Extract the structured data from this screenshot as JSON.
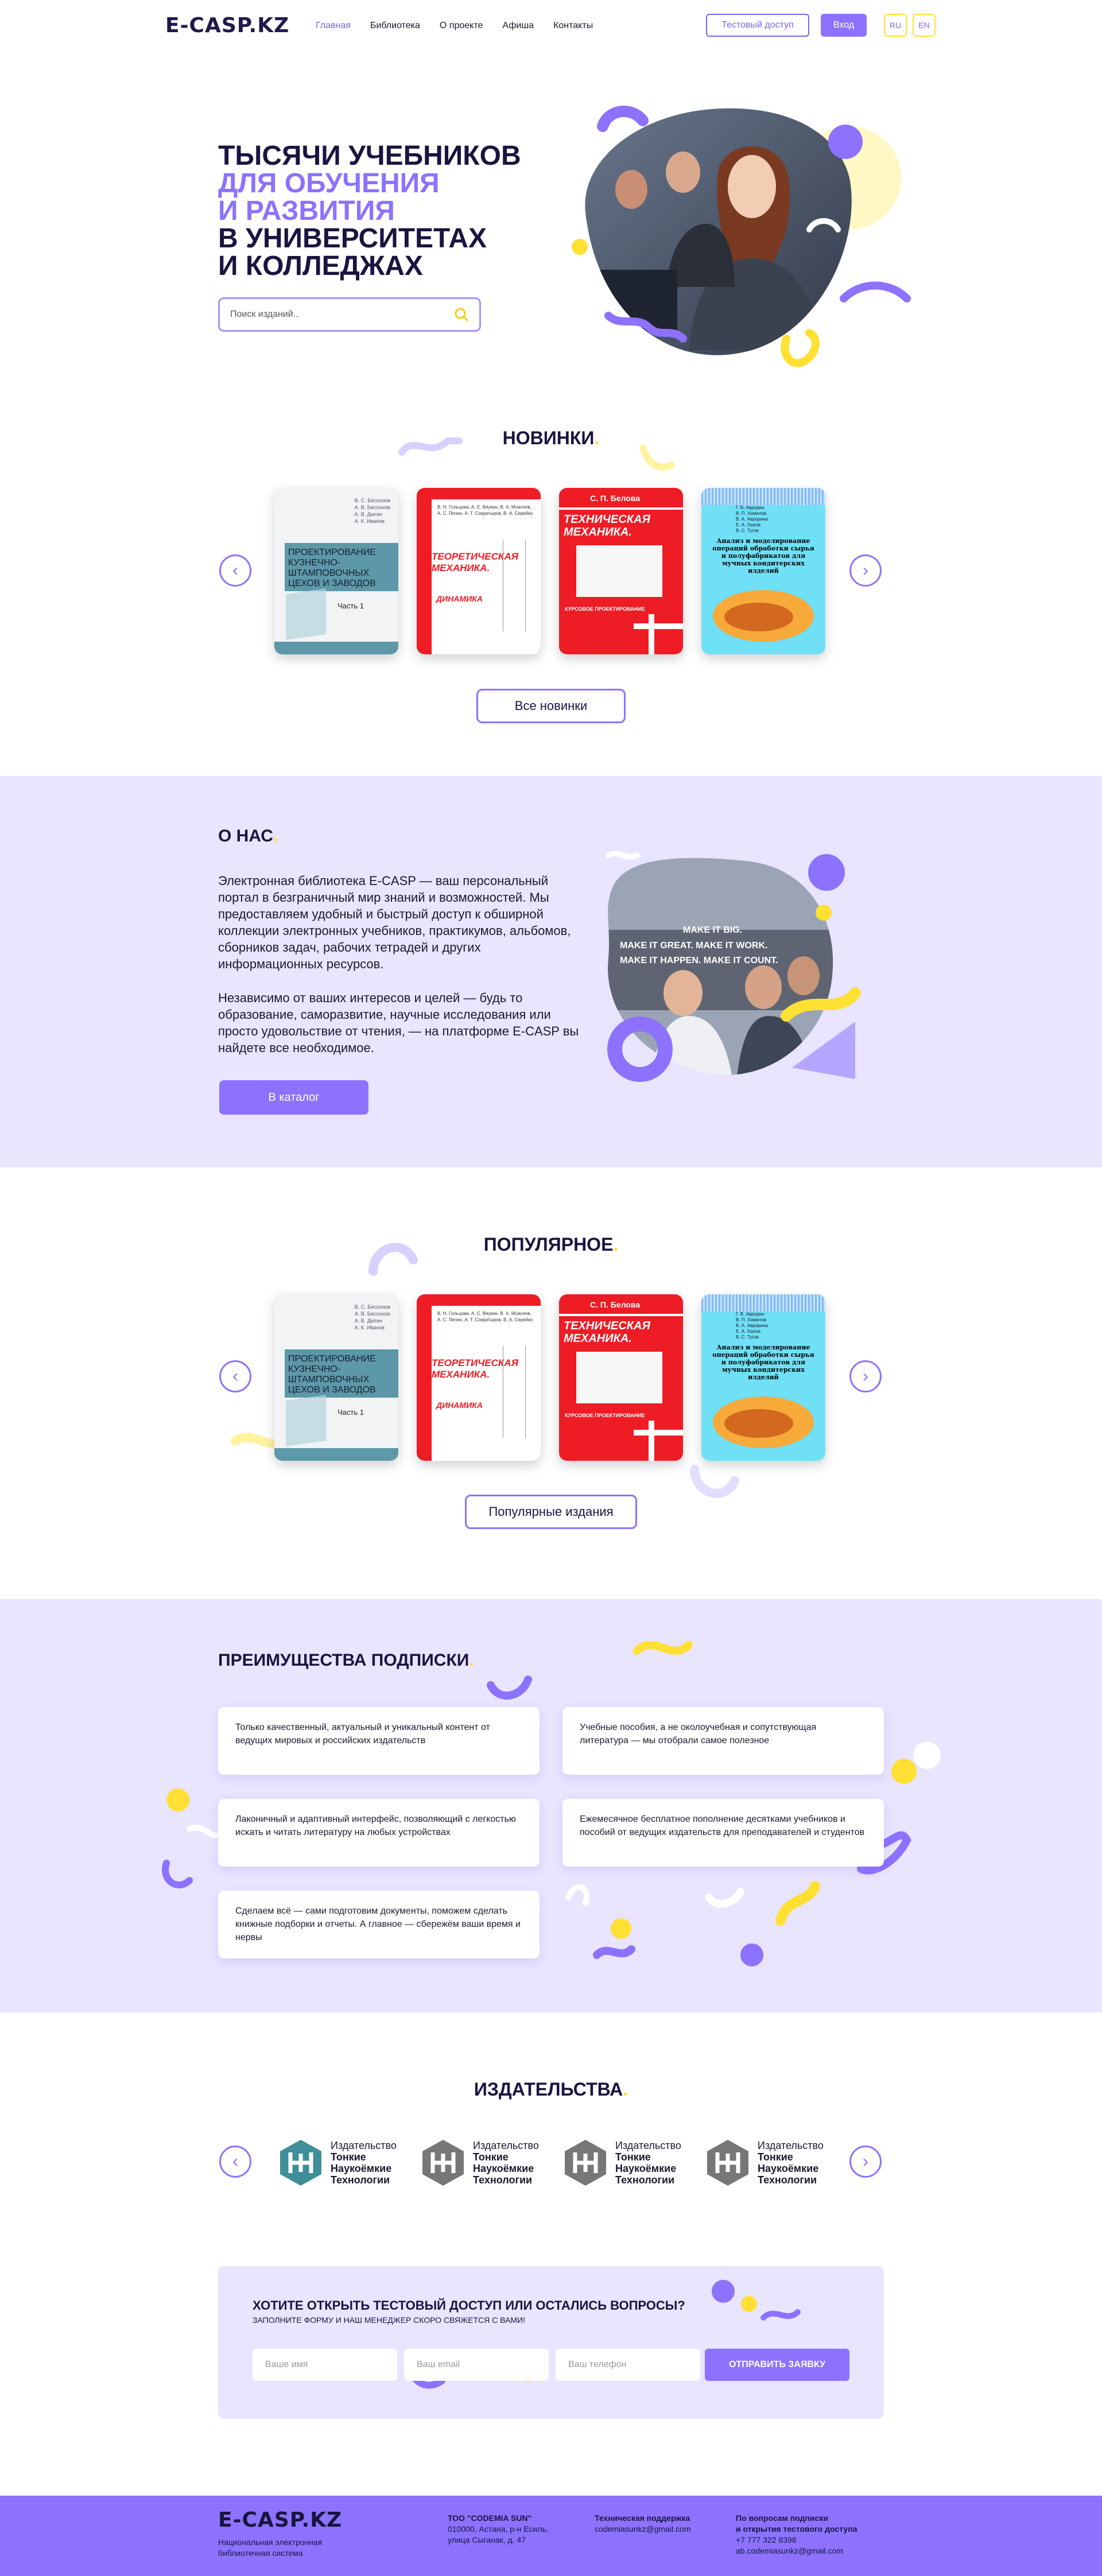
{
  "header": {
    "logo": "E-CASP.KZ",
    "nav": [
      "Главная",
      "Библиотека",
      "О проекте",
      "Афиша",
      "Контакты"
    ],
    "test_access": "Тестовый доступ",
    "login": "Вход",
    "lang_ru": "RU",
    "lang_en": "EN"
  },
  "hero": {
    "line1": "ТЫСЯЧИ УЧЕБНИКОВ",
    "line2": "ДЛЯ ОБУЧЕНИЯ",
    "line3": "И РАЗВИТИЯ",
    "line4": "В УНИВЕРСИТЕТАХ",
    "line5": "И КОЛЛЕДЖАХ",
    "search_placeholder": "Поиск изданий.."
  },
  "new": {
    "title": "НОВИНКИ",
    "button": "Все новинки"
  },
  "books": [
    {
      "authors": "В. С. Бессонов\nА. В. Бессонов\nА. В. Дюгин\nА. К. Иванов",
      "title": "ПРОЕКТИРОВАНИЕ КУЗНЕЧНО-ШТАМПОВОЧНЫХ ЦЕХОВ И ЗАВОДОВ",
      "part": "Часть 1"
    },
    {
      "authors": "В. Н. Гольцова, А. С. Вяукин, В. А. Моисеев, А. С. Лепин, А. Т. Сократыров, В. А. Серейко",
      "title": "ТЕОРЕТИЧЕСКАЯ МЕХАНИКА.",
      "sub": "ДИНАМИКА"
    },
    {
      "authors": "С. П. Белова",
      "title": "ТЕХНИЧЕСКАЯ МЕХАНИКА.",
      "sub": "КУРСОВОЕ ПРОЕКТИРОВАНИЕ"
    },
    {
      "authors": "Г. В. Аврорин\nВ. П. Хомилов\nВ. А. Аврорина\nЕ. А. Ушков\nВ. С. Тугов",
      "title": "Анализ и моделирование операций обработки сырья и полуфабрикатов для мучных кондитерских изделий"
    }
  ],
  "about": {
    "title": "О НАС",
    "p1": "Электронная библиотека E-CASP — ваш персональный портал в безграничный мир знаний и возможностей. Мы предоставляем удобный и быстрый доступ к обширной коллекции электронных учебников, практикумов, альбомов, сборников задач, рабочих тетрадей и других информационных ресурсов.",
    "p2": "Независимо от ваших интересов и целей — будь то образование, саморазвитие, научные исследования или просто удовольствие от чтения, — на платформе E-CASP вы найдете все необходимое.",
    "button": "В каталог",
    "img_text1": "MAKE IT BIG.",
    "img_text2": "MAKE IT GREAT. MAKE IT WORK.",
    "img_text3": "MAKE IT HAPPEN. MAKE IT COUNT."
  },
  "popular": {
    "title": "ПОПУЛЯРНОЕ",
    "button": "Популярные издания"
  },
  "benefits": {
    "title": "ПРЕИМУЩЕСТВА ПОДПИСКИ",
    "items": [
      "Только качественный, актуальный и уникальный контент от ведущих мировых и российских издательств",
      "Учебные пособия, а не околоучебная и сопутствующая литература — мы отобрали самое полезное",
      "Лаконичный и адаптивный интерфейс, позволяющий с легкостью искать и читать литературу на любых устройствах",
      "Ежемесячное бесплатное пополнение десятками учебников и пособий от ведущих издательств для преподавателей и студентов",
      "Сделаем всё — сами подготовим документы, поможем сделать книжные подборки и отчеты. А главное — сбережём ваши время и нервы"
    ]
  },
  "publishers": {
    "title": "ИЗДАТЕЛЬСТВА",
    "items": [
      {
        "l1": "Издательство",
        "l2": "Тонкие",
        "l3": "Наукоёмкие",
        "l4": "Технологии"
      },
      {
        "l1": "Издательство",
        "l2": "Тонкие",
        "l3": "Наукоёмкие",
        "l4": "Технологии"
      },
      {
        "l1": "Издательство",
        "l2": "Тонкие",
        "l3": "Наукоёмкие",
        "l4": "Технологии"
      },
      {
        "l1": "Издательство",
        "l2": "Тонкие",
        "l3": "Наукоёмкие",
        "l4": "Технологии"
      }
    ]
  },
  "contact": {
    "title": "ХОТИТЕ ОТКРЫТЬ ТЕСТОВЫЙ ДОСТУП ИЛИ ОСТАЛИСЬ ВОПРОСЫ?",
    "subtitle": "ЗАПОЛНИТЕ ФОРМУ И НАШ МЕНЕДЖЕР СКОРО СВЯЖЕТСЯ С ВАМИ!",
    "name_placeholder": "Ваше имя",
    "email_placeholder": "Ваш email",
    "phone_placeholder": "Ваш телефон",
    "submit": "ОТПРАВИТЬ ЗАЯВКУ"
  },
  "footer": {
    "logo": "E-CASP.KZ",
    "tagline1": "Национальная электронная",
    "tagline2": "библиотечная система",
    "company": "ТОО \"CODEMIA SUN\"",
    "addr1": "010000, Астана, р-н Есиль,",
    "addr2": "улица Сыганак, д. 47",
    "support_title": "Техническая поддержка",
    "support_email": "codemiasunkz@gmail.com",
    "q_title1": "По вопросам подписки",
    "q_title2": "и открытия тестового доступа",
    "phone": "+7 777 322 8398",
    "q_email": "ab.codemiasunkz@gmail.com"
  },
  "colors": {
    "accent": "#8c72ff",
    "yellow": "#ffe033",
    "lavender": "#e9e4ff",
    "dark": "#1a1440"
  }
}
